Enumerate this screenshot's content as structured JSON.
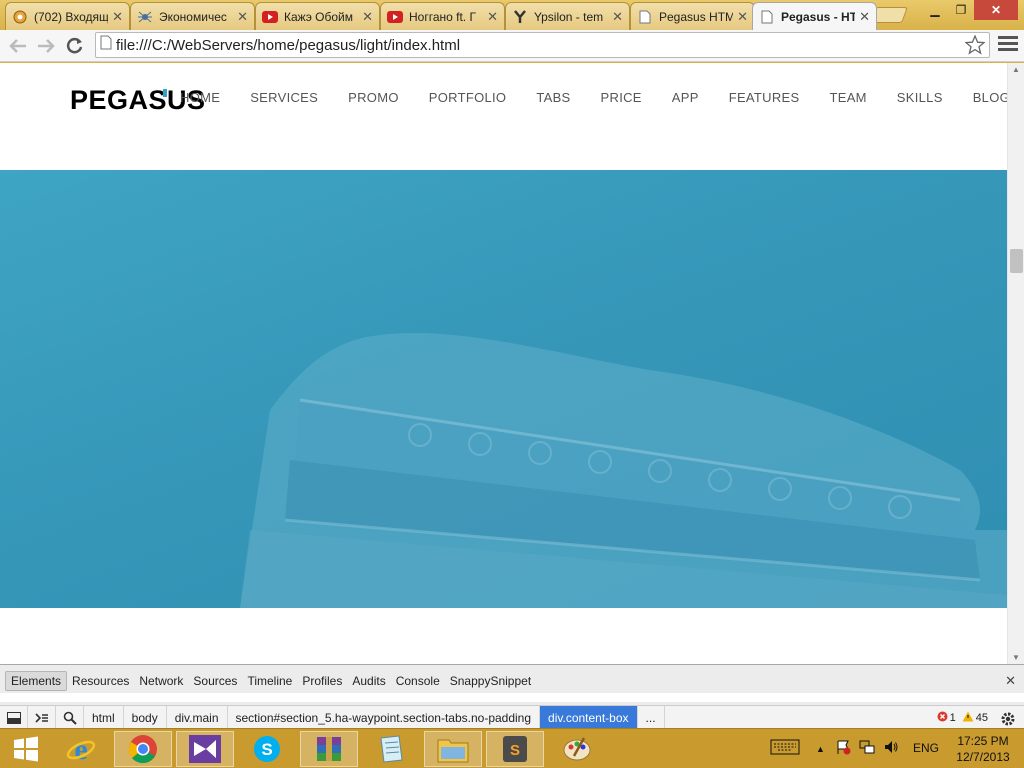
{
  "browser": {
    "tabs": [
      {
        "title": "(702) Входящ",
        "icon": "mail-icon"
      },
      {
        "title": "Экономичес",
        "icon": "spider-icon"
      },
      {
        "title": "Кажэ Обойм",
        "icon": "youtube-icon"
      },
      {
        "title": "Ноггано ft. Г",
        "icon": "youtube-icon"
      },
      {
        "title": "Ypsilon - tem",
        "icon": "ypsilon-icon"
      },
      {
        "title": "Pegasus HTM",
        "icon": "page-icon"
      },
      {
        "title": "Pegasus - HT",
        "icon": "page-icon",
        "active": true
      }
    ],
    "url": "file:///C:/WebServers/home/pegasus/light/index.html"
  },
  "site": {
    "logo": "PEGASUS",
    "nav": [
      "HOME",
      "SERVICES",
      "PROMO",
      "PORTFOLIO",
      "TABS",
      "PRICE",
      "APP",
      "FEATURES",
      "TEAM",
      "SKILLS",
      "BLOG"
    ],
    "accent_color": "#31a3c6",
    "hero_color": "#3697b9"
  },
  "devtools": {
    "tabs": [
      "Elements",
      "Resources",
      "Network",
      "Sources",
      "Timeline",
      "Profiles",
      "Audits",
      "Console",
      "SnappySnippet"
    ],
    "active_tab": "Elements",
    "breadcrumbs": [
      "html",
      "body",
      "div.main",
      "section#section_5.ha-waypoint.section-tabs.no-padding",
      "div.content-box",
      "..."
    ],
    "active_crumb": "div.content-box",
    "errors": "1",
    "warnings": "45"
  },
  "taskbar": {
    "apps": [
      "windows-start-icon",
      "ie-icon",
      "chrome-icon",
      "visual-studio-icon",
      "skype-icon",
      "winrar-icon",
      "notepad-icon",
      "explorer-icon",
      "sublime-icon",
      "paint-icon"
    ],
    "language": "ENG",
    "time": "17:25 PM",
    "date": "12/7/2013"
  }
}
